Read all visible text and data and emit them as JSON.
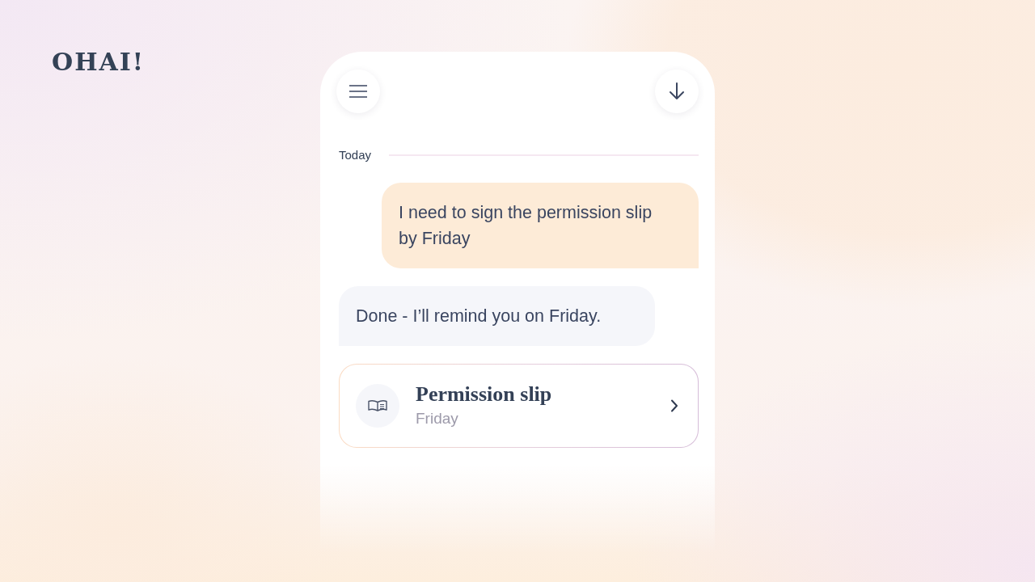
{
  "logo": {
    "text": "OHAI!"
  },
  "chat": {
    "date_divider": "Today",
    "messages": [
      {
        "kind": "sent",
        "text": "I need to sign the permission slip by Friday"
      },
      {
        "kind": "received",
        "text": "Done - I’ll remind you on Friday."
      }
    ],
    "reminder_card": {
      "title": "Permission slip",
      "subtitle": "Friday"
    }
  }
}
